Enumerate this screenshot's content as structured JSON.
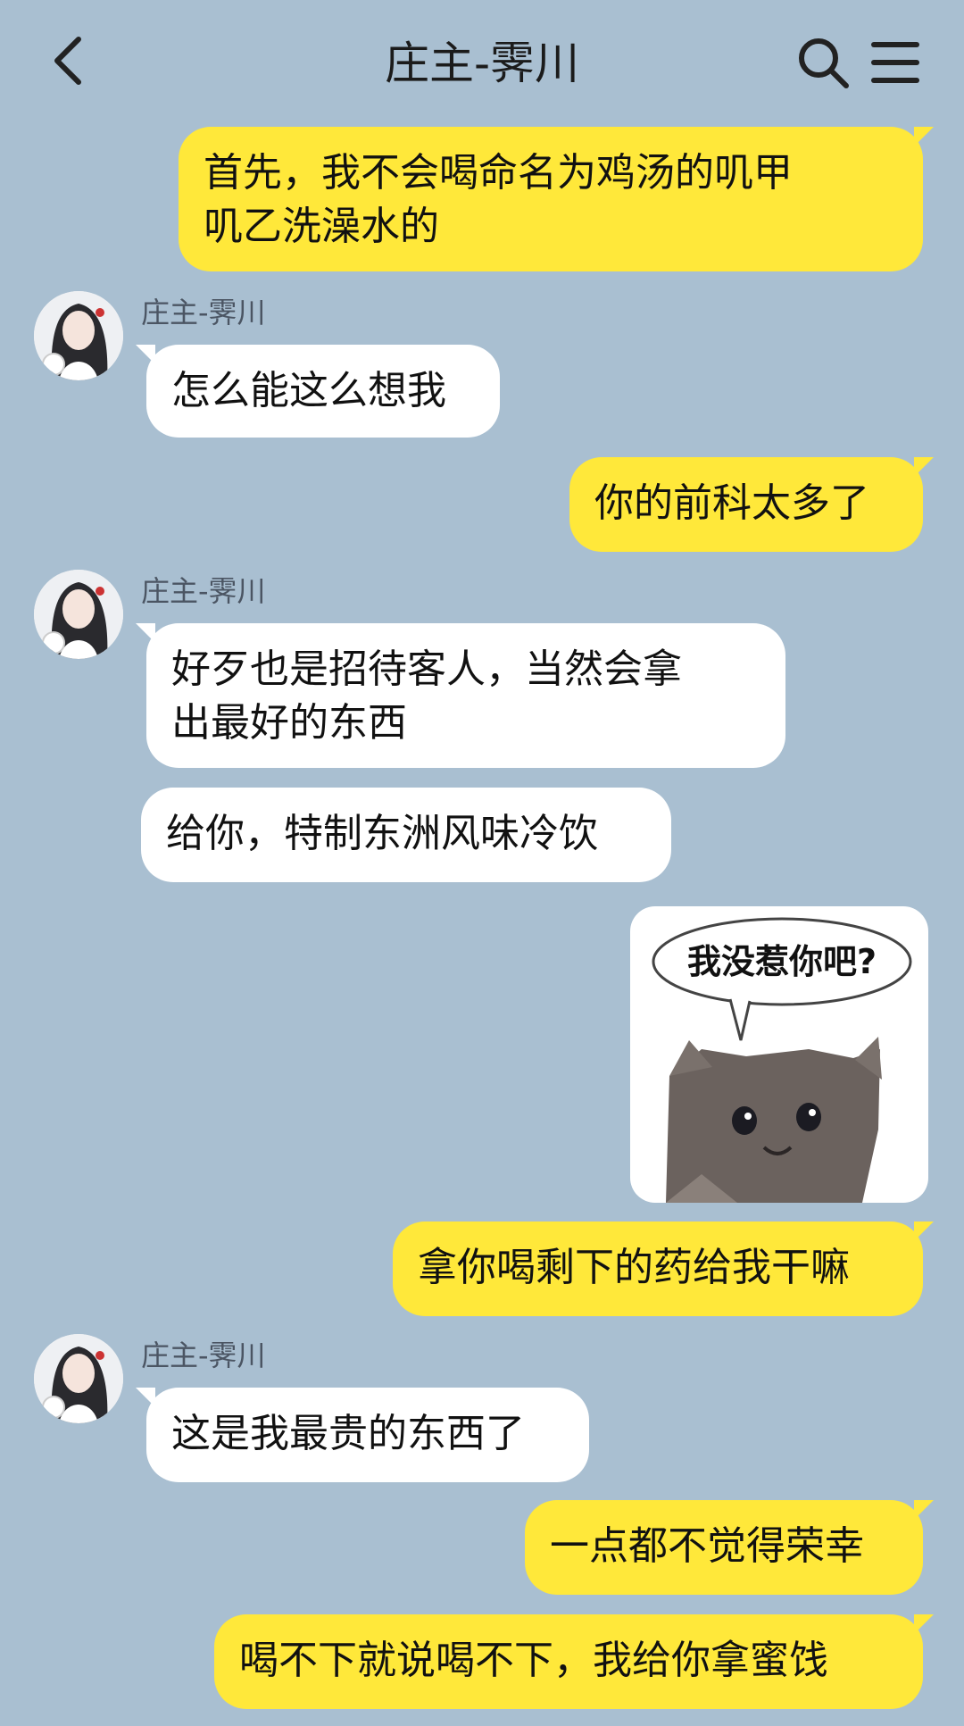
{
  "header": {
    "title": "庄主-霁川",
    "back_icon": "chevron-left-icon",
    "search_icon": "search-icon",
    "menu_icon": "menu-icon"
  },
  "contact": {
    "name": "庄主-霁川"
  },
  "messages": [
    {
      "from": "me",
      "text": "首先，我不会喝命名为鸡汤的叽甲\n叽乙洗澡水的"
    },
    {
      "from": "them",
      "text": "怎么能这么想我"
    },
    {
      "from": "me",
      "text": "你的前科太多了"
    },
    {
      "from": "them",
      "text": "好歹也是招待客人，当然会拿\n出最好的东西"
    },
    {
      "from": "them",
      "text": "给你，特制东洲风味冷饮"
    },
    {
      "from": "me",
      "sticker_text": "我没惹你吧?"
    },
    {
      "from": "me",
      "text": "拿你喝剩下的药给我干嘛"
    },
    {
      "from": "them",
      "text": "这是我最贵的东西了"
    },
    {
      "from": "me",
      "text": "一点都不觉得荣幸"
    },
    {
      "from": "me",
      "text": "喝不下就说喝不下，我给你拿蜜饯"
    }
  ],
  "colors": {
    "background": "#a9bfd1",
    "my_bubble": "#ffe83a",
    "their_bubble": "#ffffff"
  }
}
